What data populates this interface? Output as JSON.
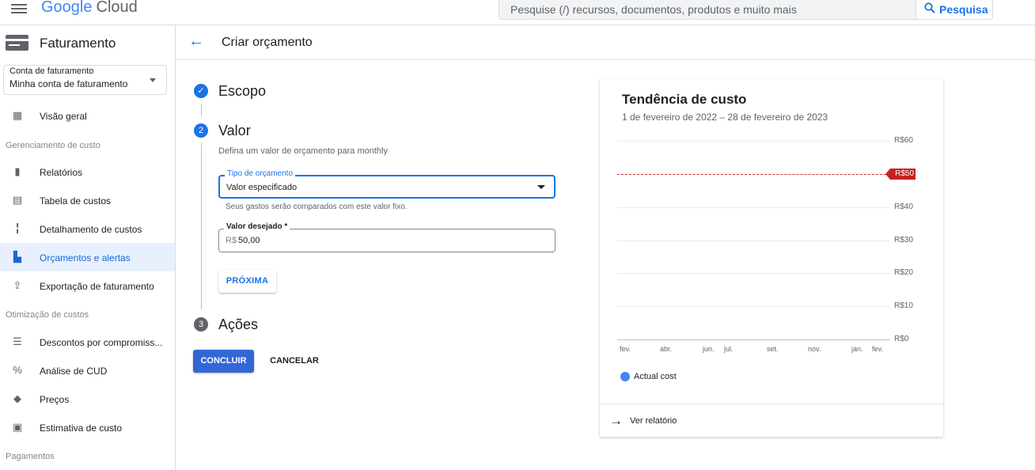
{
  "topbar": {
    "logo_google": "Google",
    "logo_cloud": "Cloud",
    "search_placeholder": "Pesquise (/) recursos, documentos, produtos e muito mais",
    "search_button": "Pesquisa"
  },
  "sidebar": {
    "title": "Faturamento",
    "account_label": "Conta de faturamento",
    "account_value": "Minha conta de faturamento",
    "overview": "Visão geral",
    "section_cost": "Gerenciamento de custo",
    "items_cost": [
      "Relatórios",
      "Tabela de custos",
      "Detalhamento de custos",
      "Orçamentos e alertas",
      "Exportação de faturamento"
    ],
    "section_opt": "Otimização de custos",
    "items_opt": [
      "Descontos por compromiss...",
      "Análise de CUD",
      "Preços",
      "Estimativa de custo"
    ],
    "section_pay": "Pagamentos"
  },
  "header": {
    "title": "Criar orçamento"
  },
  "form": {
    "step1_num": "✓",
    "step1_title": "Escopo",
    "step2_num": "2",
    "step2_title": "Valor",
    "step2_desc": "Defina um valor de orçamento para monthly",
    "type_label": "Tipo de orçamento",
    "type_value": "Valor especificado",
    "type_hint": "Seus gastos serão comparados com este valor fixo.",
    "amount_label": "Valor desejado *",
    "amount_prefix": "R$",
    "amount_value": "50,00",
    "next_button": "PRÓXIMA",
    "step3_num": "3",
    "step3_title": "Ações",
    "done_button": "CONCLUIR",
    "cancel_button": "CANCELAR"
  },
  "chart_card": {
    "title": "Tendência de custo",
    "subtitle": "1 de fevereiro de 2022 – 28 de fevereiro de 2023",
    "budget_label": "R$50",
    "legend": "Actual cost",
    "link": "Ver relatório"
  },
  "chart_data": {
    "type": "line",
    "yticks": [
      "R$60",
      "R$50",
      "R$40",
      "R$30",
      "R$20",
      "R$10",
      "R$0"
    ],
    "xticks": [
      "fev.",
      "abr.",
      "jun.",
      "jul.",
      "set.",
      "nov.",
      "jan.",
      "fev."
    ],
    "ylim": [
      0,
      60
    ],
    "budget": 50,
    "series": [
      {
        "name": "Actual cost",
        "values": []
      }
    ],
    "legend_position": "bottom-left",
    "colors": {
      "actual": "#4285f4",
      "budget": "#d93025"
    }
  }
}
